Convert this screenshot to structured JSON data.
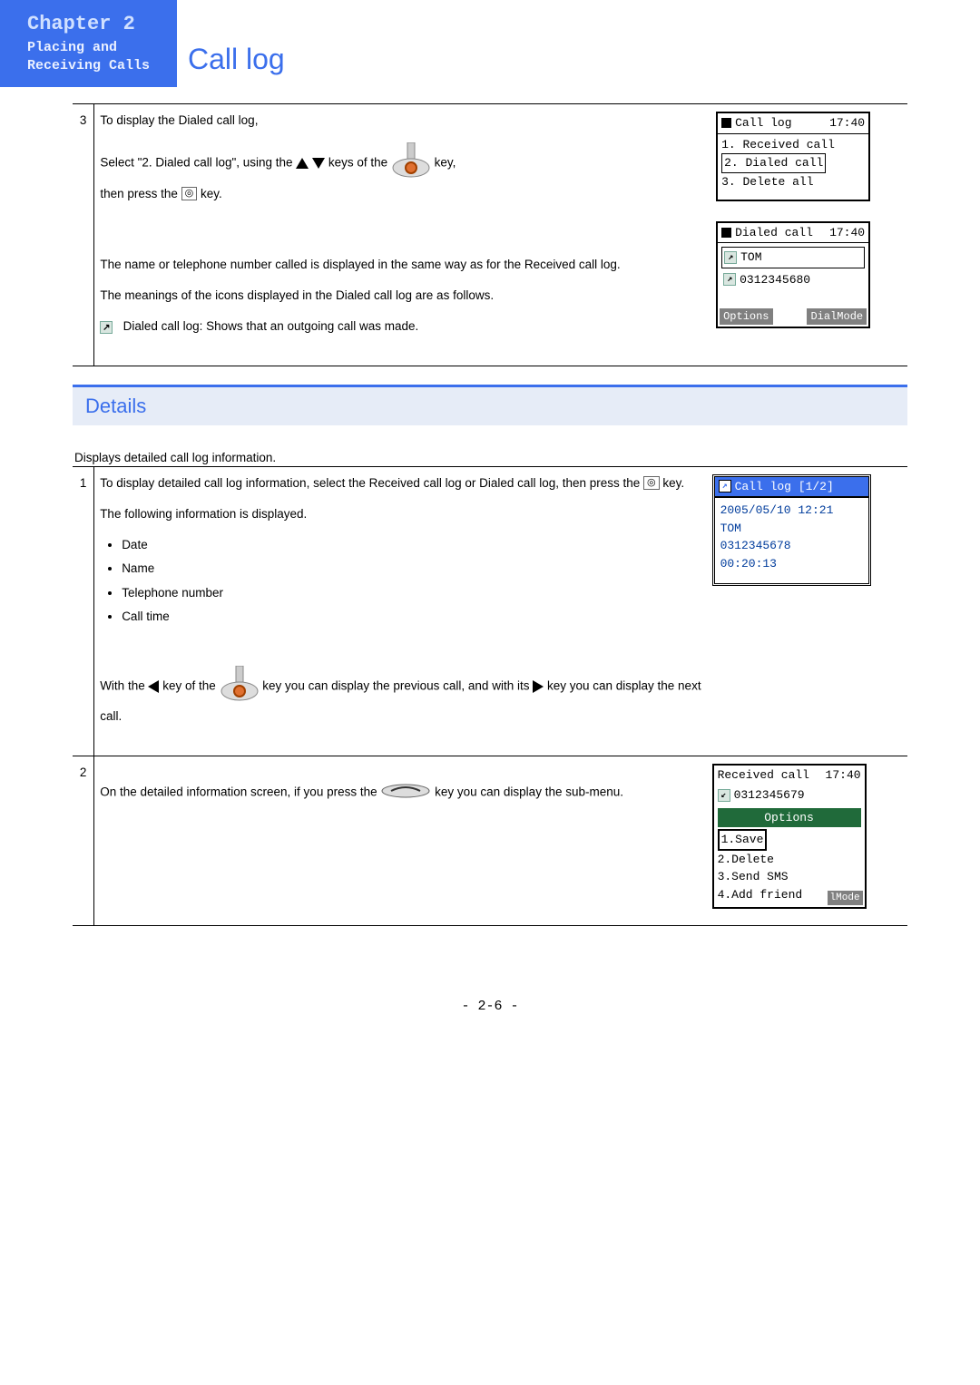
{
  "chapter": {
    "title": "Chapter 2",
    "sub1": "Placing and",
    "sub2": "Receiving Calls"
  },
  "pageTitle": "Call log",
  "step3": {
    "num": "3",
    "p1": "To display the Dialed call log,",
    "p2a": "Select \"2. Dialed call log\", using the ",
    "p2b": " keys of the ",
    "p2c": " key,",
    "p3a": "then press the ",
    "p3b": " key.",
    "p4": "The name or telephone number called is displayed in the same way as for the Received call log.",
    "p5": "The meanings of the icons displayed in the Dialed call log are as follows.",
    "p6": "Dialed call log:  Shows that an outgoing call was made."
  },
  "phone1": {
    "title": "Call log",
    "time": "17:40",
    "i1": "1. Received call",
    "i2": "2. Dialed call",
    "i3": "3. Delete all"
  },
  "phone2": {
    "title": "Dialed call",
    "time": "17:40",
    "name": "TOM",
    "num": "0312345680",
    "sk1": "Options",
    "sk2": "DialMode"
  },
  "detailsHeader": "Details",
  "detailsIntro": "Displays detailed call log information.",
  "step1": {
    "num": "1",
    "p1a": "To display detailed call log information, select the Received call log or Dialed call log, then press the ",
    "p1b": " key.",
    "p2": "The following information is displayed.",
    "b1": "Date",
    "b2": "Name",
    "b3": "Telephone number",
    "b4": "Call time",
    "p3a": "With the ",
    "p3b": " key of the ",
    "p3c": " key you can display the previous call, and with its ",
    "p3d": " key you can display the next call."
  },
  "phoneDetail": {
    "title": "Call log [1/2]",
    "date": "2005/05/10 12:21",
    "name": "TOM",
    "num": "0312345678",
    "dur": "00:20:13"
  },
  "step2": {
    "num": "2",
    "p1a": "On the detailed information screen, if you press the ",
    "p1b": " key you can display the sub-menu."
  },
  "phoneOpt": {
    "title": "Received call",
    "time": "17:40",
    "num": "0312345679",
    "header": "Options",
    "o1": "1.Save",
    "o2": "2.Delete",
    "o3": "3.Send SMS",
    "o4": "4.Add friend",
    "mode": "lMode"
  },
  "glyph": {
    "center": "◎",
    "outArrow": "↗",
    "inArrow": "↙"
  },
  "footer": "- 2-6 -"
}
